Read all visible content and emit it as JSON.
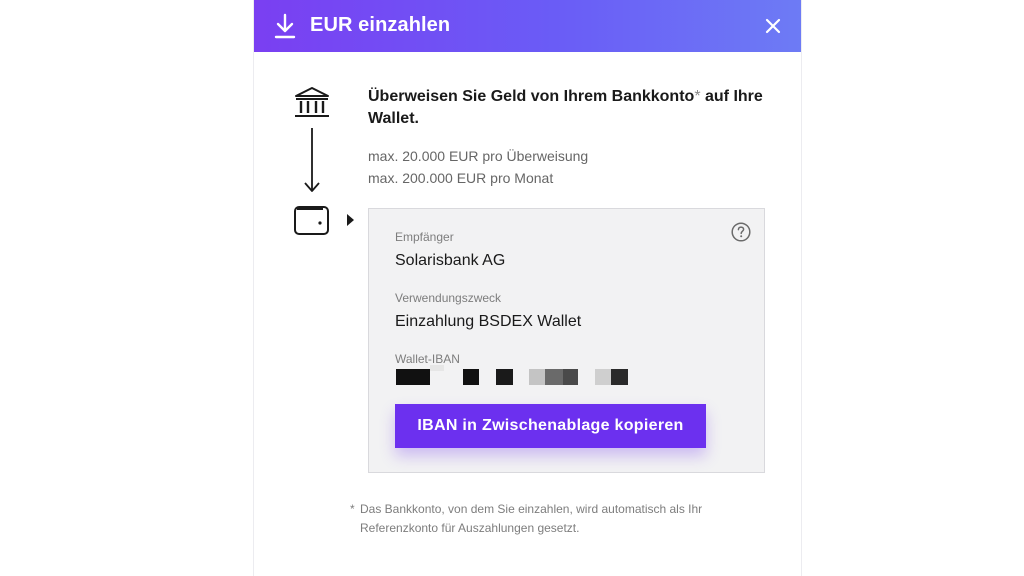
{
  "header": {
    "title": "EUR einzahlen",
    "accent_gradient": [
      "#7a3ff2",
      "#6d7bf5"
    ],
    "icon": "download-icon",
    "close_icon": "close-icon"
  },
  "intro": {
    "title": "Überweisen Sie Geld von Ihrem Bankkonto",
    "title_asterisk": "*",
    "title_suffix": " auf Ihre Wallet.",
    "limit_transfer": "max. 20.000 EUR pro Überweisung",
    "limit_month": "max. 200.000 EUR pro Monat"
  },
  "flow": {
    "from_icon": "bank-icon",
    "to_icon": "wallet-icon"
  },
  "card": {
    "recipient_label": "Empfänger",
    "recipient_value": "Solarisbank AG",
    "purpose_label": "Verwendungszweck",
    "purpose_value": "Einzahlung BSDEX Wallet",
    "iban_label": "Wallet-IBAN",
    "iban_note": "redacted",
    "copy_button": "IBAN in Zwischenablage kopieren",
    "help_icon": "question-circle-icon",
    "button_color": "#6c30ef"
  },
  "footnote": {
    "star": "*",
    "text": "Das Bankkonto, von dem Sie einzahlen, wird automatisch als Ihr Referenzkonto für Auszahlungen gesetzt."
  }
}
